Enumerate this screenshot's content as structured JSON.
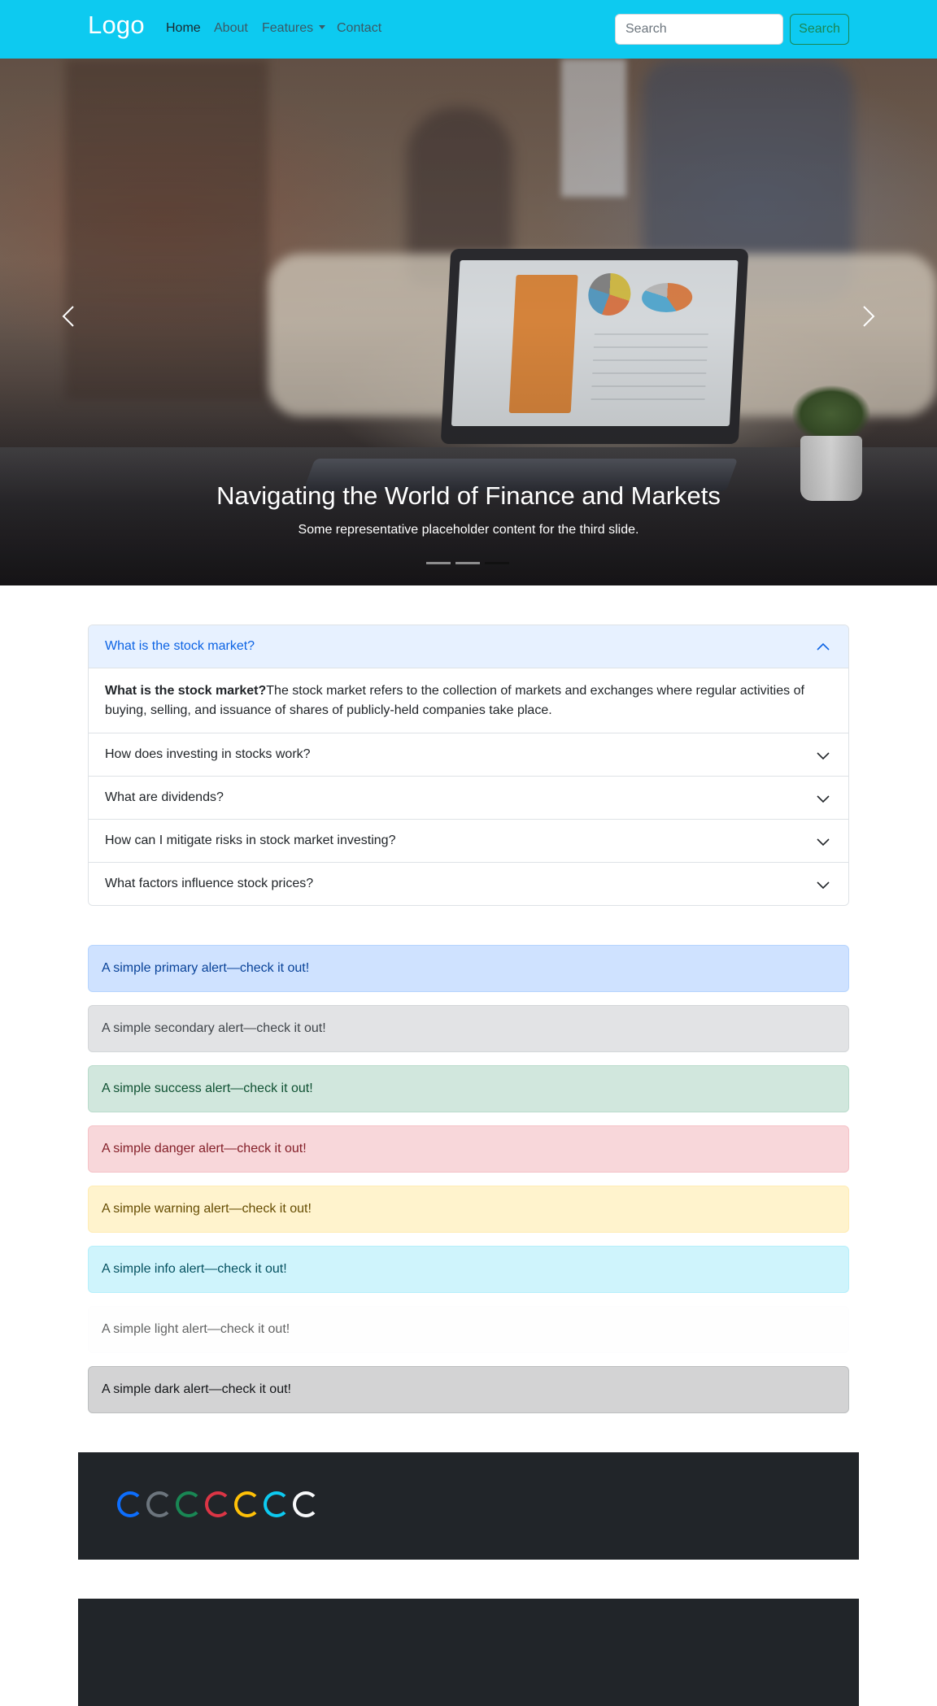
{
  "navbar": {
    "brand": "Logo",
    "links": [
      {
        "label": "Home",
        "active": true
      },
      {
        "label": "About",
        "active": false
      },
      {
        "label": "Features",
        "active": false,
        "dropdown": true
      },
      {
        "label": "Contact",
        "active": false
      }
    ],
    "search": {
      "placeholder": "Search",
      "value": "",
      "button_label": "Search"
    },
    "bg_color": "#0dcaf0"
  },
  "carousel": {
    "slide": {
      "title": "Navigating the World of Finance and Markets",
      "text": "Some representative placeholder content for the third slide."
    },
    "indicators": {
      "count": 3,
      "active_index": 2
    },
    "prev_icon": "chevron-left-icon",
    "next_icon": "chevron-right-icon"
  },
  "accordion": {
    "items": [
      {
        "question": "What is the stock market?",
        "open": true,
        "answer_bold": "What is the stock market?",
        "answer": "The stock market refers to the collection of markets and exchanges where regular activities of buying, selling, and issuance of shares of publicly-held companies take place."
      },
      {
        "question": "How does investing in stocks work?",
        "open": false
      },
      {
        "question": "What are dividends?",
        "open": false
      },
      {
        "question": "How can I mitigate risks in stock market investing?",
        "open": false
      },
      {
        "question": "What factors influence stock prices?",
        "open": false
      }
    ]
  },
  "alerts": [
    {
      "variant": "primary",
      "text": "A simple primary alert—check it out!"
    },
    {
      "variant": "secondary",
      "text": "A simple secondary alert—check it out!"
    },
    {
      "variant": "success",
      "text": "A simple success alert—check it out!"
    },
    {
      "variant": "danger",
      "text": "A simple danger alert—check it out!"
    },
    {
      "variant": "warning",
      "text": "A simple warning alert—check it out!"
    },
    {
      "variant": "info",
      "text": "A simple info alert—check it out!"
    },
    {
      "variant": "light",
      "text": "A simple light alert—check it out!"
    },
    {
      "variant": "dark",
      "text": "A simple dark alert—check it out!"
    }
  ],
  "spinners": {
    "colors": [
      "#0d6efd",
      "#6c757d",
      "#198754",
      "#dc3545",
      "#ffc107",
      "#0dcaf0",
      "#f8f9fa"
    ]
  }
}
